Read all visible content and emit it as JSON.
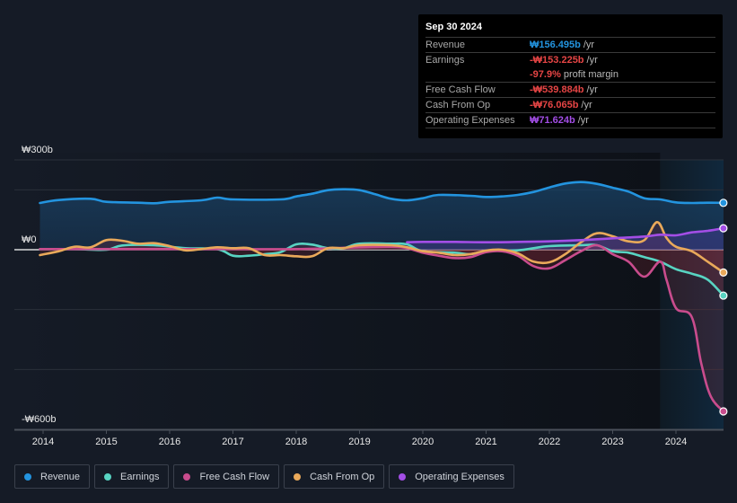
{
  "tooltip": {
    "date": "Sep 30 2024",
    "rows": [
      {
        "label": "Revenue",
        "value": "₩156.495b",
        "suffix": "/yr",
        "color": "#2394df"
      },
      {
        "label": "Earnings",
        "value": "-₩153.225b",
        "suffix": "/yr",
        "color": "#e64545"
      },
      {
        "label": "",
        "value": "-97.9%",
        "suffix": "profit margin",
        "color": "#e64545"
      },
      {
        "label": "Free Cash Flow",
        "value": "-₩539.884b",
        "suffix": "/yr",
        "color": "#e64545"
      },
      {
        "label": "Cash From Op",
        "value": "-₩76.065b",
        "suffix": "/yr",
        "color": "#e64545"
      },
      {
        "label": "Operating Expenses",
        "value": "₩71.624b",
        "suffix": "/yr",
        "color": "#a34ee6"
      }
    ]
  },
  "chart_data": {
    "type": "line",
    "title": "",
    "xlabel": "",
    "ylabel": "",
    "currency": "KRW",
    "units": "billions",
    "ylim": [
      -600,
      300
    ],
    "y_tick_labels": [
      {
        "value": 300,
        "label": "₩300b"
      },
      {
        "value": 0,
        "label": "₩0"
      },
      {
        "value": -600,
        "label": "-₩600b"
      }
    ],
    "gridlines": [
      300,
      200,
      0,
      -200,
      -400,
      -600
    ],
    "grid": true,
    "xlim": [
      2013.95,
      2024.75
    ],
    "x_ticks": [
      "2014",
      "2015",
      "2016",
      "2017",
      "2018",
      "2019",
      "2020",
      "2021",
      "2022",
      "2023",
      "2024"
    ],
    "highlight_region_start": 2023.75,
    "legend_position": "bottom-left",
    "series": [
      {
        "name": "Revenue",
        "color": "#2394df",
        "fill": true,
        "points": [
          [
            2013.95,
            156
          ],
          [
            2014.25,
            166
          ],
          [
            2014.75,
            170
          ],
          [
            2015.0,
            160
          ],
          [
            2015.5,
            157
          ],
          [
            2015.75,
            155
          ],
          [
            2016.0,
            160
          ],
          [
            2016.5,
            165
          ],
          [
            2016.75,
            174
          ],
          [
            2017.0,
            168
          ],
          [
            2017.75,
            168
          ],
          [
            2018.0,
            178
          ],
          [
            2018.25,
            187
          ],
          [
            2018.5,
            199
          ],
          [
            2018.75,
            202
          ],
          [
            2019.0,
            199
          ],
          [
            2019.25,
            185
          ],
          [
            2019.5,
            170
          ],
          [
            2019.75,
            165
          ],
          [
            2020.0,
            172
          ],
          [
            2020.25,
            183
          ],
          [
            2020.75,
            180
          ],
          [
            2021.0,
            176
          ],
          [
            2021.25,
            178
          ],
          [
            2021.5,
            183
          ],
          [
            2021.75,
            193
          ],
          [
            2022.0,
            208
          ],
          [
            2022.25,
            221
          ],
          [
            2022.5,
            226
          ],
          [
            2022.75,
            220
          ],
          [
            2023.0,
            207
          ],
          [
            2023.25,
            194
          ],
          [
            2023.5,
            172
          ],
          [
            2023.75,
            168
          ],
          [
            2024.0,
            158
          ],
          [
            2024.25,
            156
          ],
          [
            2024.5,
            157
          ],
          [
            2024.75,
            156.5
          ]
        ]
      },
      {
        "name": "Earnings",
        "color": "#58d4c2",
        "fill": false,
        "points": [
          [
            2013.95,
            2
          ],
          [
            2014.5,
            2
          ],
          [
            2015.0,
            0
          ],
          [
            2015.25,
            14
          ],
          [
            2015.75,
            15
          ],
          [
            2016.25,
            5
          ],
          [
            2016.75,
            2
          ],
          [
            2017.0,
            -20
          ],
          [
            2017.25,
            -20
          ],
          [
            2017.5,
            -15
          ],
          [
            2017.75,
            -8
          ],
          [
            2018.0,
            18
          ],
          [
            2018.25,
            17
          ],
          [
            2018.5,
            5
          ],
          [
            2018.75,
            5
          ],
          [
            2019.0,
            20
          ],
          [
            2019.5,
            20
          ],
          [
            2019.75,
            18
          ],
          [
            2020.0,
            -5
          ],
          [
            2020.5,
            -10
          ],
          [
            2020.75,
            -15
          ],
          [
            2021.0,
            -5
          ],
          [
            2021.5,
            -2
          ],
          [
            2021.75,
            5
          ],
          [
            2022.0,
            12
          ],
          [
            2022.5,
            15
          ],
          [
            2022.75,
            15
          ],
          [
            2023.0,
            -5
          ],
          [
            2023.25,
            -10
          ],
          [
            2023.5,
            -25
          ],
          [
            2023.75,
            -40
          ],
          [
            2024.0,
            -65
          ],
          [
            2024.25,
            -80
          ],
          [
            2024.5,
            -100
          ],
          [
            2024.75,
            -153.2
          ]
        ]
      },
      {
        "name": "Free Cash Flow",
        "color": "#c94c8d",
        "fill": false,
        "points": [
          [
            2013.95,
            2
          ],
          [
            2015.0,
            2
          ],
          [
            2016.0,
            2
          ],
          [
            2017.0,
            2
          ],
          [
            2018.0,
            2
          ],
          [
            2019.0,
            8
          ],
          [
            2019.5,
            10
          ],
          [
            2019.75,
            5
          ],
          [
            2020.0,
            -10
          ],
          [
            2020.25,
            -20
          ],
          [
            2020.5,
            -28
          ],
          [
            2020.75,
            -25
          ],
          [
            2021.0,
            -8
          ],
          [
            2021.25,
            -5
          ],
          [
            2021.5,
            -20
          ],
          [
            2021.75,
            -55
          ],
          [
            2022.0,
            -62
          ],
          [
            2022.25,
            -35
          ],
          [
            2022.5,
            -5
          ],
          [
            2022.75,
            15
          ],
          [
            2023.0,
            -15
          ],
          [
            2023.25,
            -40
          ],
          [
            2023.5,
            -90
          ],
          [
            2023.75,
            -40
          ],
          [
            2023.85,
            -100
          ],
          [
            2024.0,
            -195
          ],
          [
            2024.25,
            -225
          ],
          [
            2024.4,
            -380
          ],
          [
            2024.55,
            -490
          ],
          [
            2024.75,
            -539.9
          ]
        ]
      },
      {
        "name": "Cash From Op",
        "color": "#e9a95a",
        "fill": false,
        "points": [
          [
            2013.95,
            -18
          ],
          [
            2014.25,
            -5
          ],
          [
            2014.5,
            10
          ],
          [
            2014.75,
            8
          ],
          [
            2015.0,
            32
          ],
          [
            2015.25,
            30
          ],
          [
            2015.5,
            20
          ],
          [
            2015.75,
            22
          ],
          [
            2016.0,
            12
          ],
          [
            2016.25,
            -2
          ],
          [
            2016.5,
            2
          ],
          [
            2016.75,
            8
          ],
          [
            2017.0,
            5
          ],
          [
            2017.25,
            5
          ],
          [
            2017.5,
            -18
          ],
          [
            2017.75,
            -18
          ],
          [
            2018.0,
            -22
          ],
          [
            2018.25,
            -22
          ],
          [
            2018.5,
            5
          ],
          [
            2018.75,
            5
          ],
          [
            2019.0,
            15
          ],
          [
            2019.5,
            15
          ],
          [
            2019.75,
            8
          ],
          [
            2020.0,
            -5
          ],
          [
            2020.25,
            -10
          ],
          [
            2020.5,
            -18
          ],
          [
            2020.75,
            -15
          ],
          [
            2021.0,
            -3
          ],
          [
            2021.25,
            0
          ],
          [
            2021.5,
            -12
          ],
          [
            2021.75,
            -40
          ],
          [
            2022.0,
            -42
          ],
          [
            2022.25,
            -15
          ],
          [
            2022.5,
            25
          ],
          [
            2022.75,
            55
          ],
          [
            2023.0,
            45
          ],
          [
            2023.25,
            28
          ],
          [
            2023.5,
            32
          ],
          [
            2023.7,
            92
          ],
          [
            2023.85,
            40
          ],
          [
            2024.0,
            10
          ],
          [
            2024.25,
            -5
          ],
          [
            2024.5,
            -40
          ],
          [
            2024.75,
            -76.1
          ]
        ]
      },
      {
        "name": "Operating Expenses",
        "color": "#a34ee6",
        "fill": false,
        "points": [
          [
            2019.75,
            25
          ],
          [
            2020.0,
            26
          ],
          [
            2020.5,
            26
          ],
          [
            2021.0,
            25
          ],
          [
            2021.5,
            26
          ],
          [
            2022.0,
            28
          ],
          [
            2022.5,
            32
          ],
          [
            2023.0,
            38
          ],
          [
            2023.5,
            44
          ],
          [
            2023.75,
            50
          ],
          [
            2024.0,
            48
          ],
          [
            2024.25,
            58
          ],
          [
            2024.5,
            63
          ],
          [
            2024.75,
            71.6
          ]
        ]
      }
    ]
  },
  "legend": [
    {
      "label": "Revenue",
      "color": "#2394df"
    },
    {
      "label": "Earnings",
      "color": "#58d4c2"
    },
    {
      "label": "Free Cash Flow",
      "color": "#c94c8d"
    },
    {
      "label": "Cash From Op",
      "color": "#e9a95a"
    },
    {
      "label": "Operating Expenses",
      "color": "#a34ee6"
    }
  ]
}
